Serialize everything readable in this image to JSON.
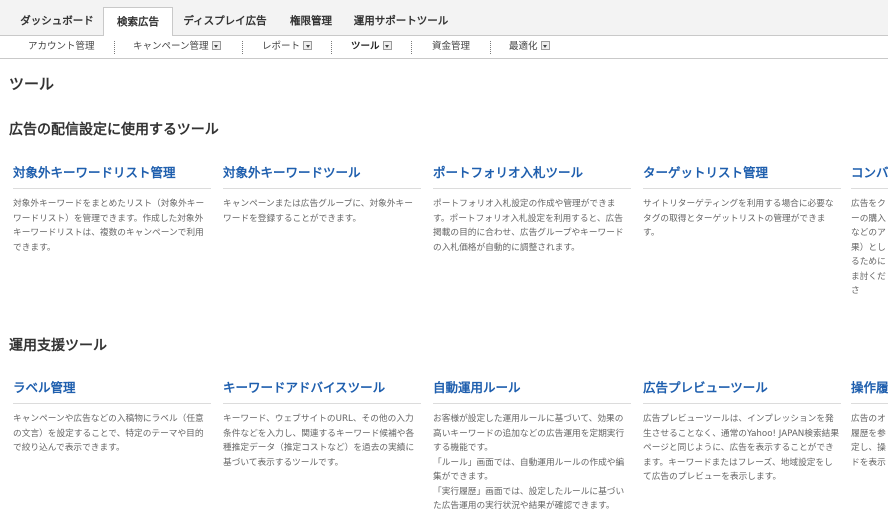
{
  "top_tabs": [
    "ダッシュボード",
    "検索広告",
    "ディスプレイ広告",
    "権限管理",
    "運用サポートツール"
  ],
  "sub_nav": [
    "アカウント管理",
    "キャンペーン管理",
    "レポート",
    "ツール",
    "資金管理",
    "最適化"
  ],
  "page_title": "ツール",
  "sections": [
    {
      "title": "広告の配信設定に使用するツール",
      "cards": [
        {
          "title": "対象外キーワードリスト管理",
          "desc": "対象外キーワードをまとめたリスト（対象外キーワードリスト）を管理できます。作成した対象外キーワードリストは、複数のキャンペーンで利用できます。"
        },
        {
          "title": "対象外キーワードツール",
          "desc": "キャンペーンまたは広告グループに、対象外キーワードを登録することができます。"
        },
        {
          "title": "ポートフォリオ入札ツール",
          "desc": "ポートフォリオ入札設定の作成や管理ができます。ポートフォリオ入札設定を利用すると、広告掲載の目的に合わせ、広告グループやキーワードの入札価格が自動的に調整されます。"
        },
        {
          "title": "ターゲットリスト管理",
          "desc": "サイトリターゲティングを利用する場合に必要なタグの取得とターゲットリストの管理ができます。"
        },
        {
          "title": "コンバ",
          "desc": "広告をクーの購入などのア果）としるためにま討くださ"
        }
      ]
    },
    {
      "title": "運用支援ツール",
      "cards": [
        {
          "title": "ラベル管理",
          "desc": "キャンペーンや広告などの入稿物にラベル（任意の文言）を設定することで、特定のテーマや目的で絞り込んで表示できます。"
        },
        {
          "title": "キーワードアドバイスツール",
          "desc": "キーワード、ウェブサイトのURL、その他の入力条件などを入力し、関連するキーワード候補や各種推定データ（推定コストなど）を過去の実績に基づいて表示するツールです。"
        },
        {
          "title": "自動運用ルール",
          "desc": "お客様が設定した運用ルールに基づいて、効果の高いキーワードの追加などの広告運用を定期実行する機能です。\n「ルール」画面では、自動運用ルールの作成や編集ができます。\n「実行履歴」画面では、設定したルールに基づいた広告運用の実行状況や結果が確認できます。"
        },
        {
          "title": "広告プレビューツール",
          "desc": "広告プレビューツールは、インプレッションを発生させることなく、通常のYahoo! JAPAN検索結果ページと同じように、広告を表示することができます。キーワードまたはフレーズ、地域設定をして広告のプレビューを表示します。"
        },
        {
          "title": "操作履",
          "desc": "広告のオ履歴を参定し、操ドを表示"
        }
      ]
    }
  ]
}
